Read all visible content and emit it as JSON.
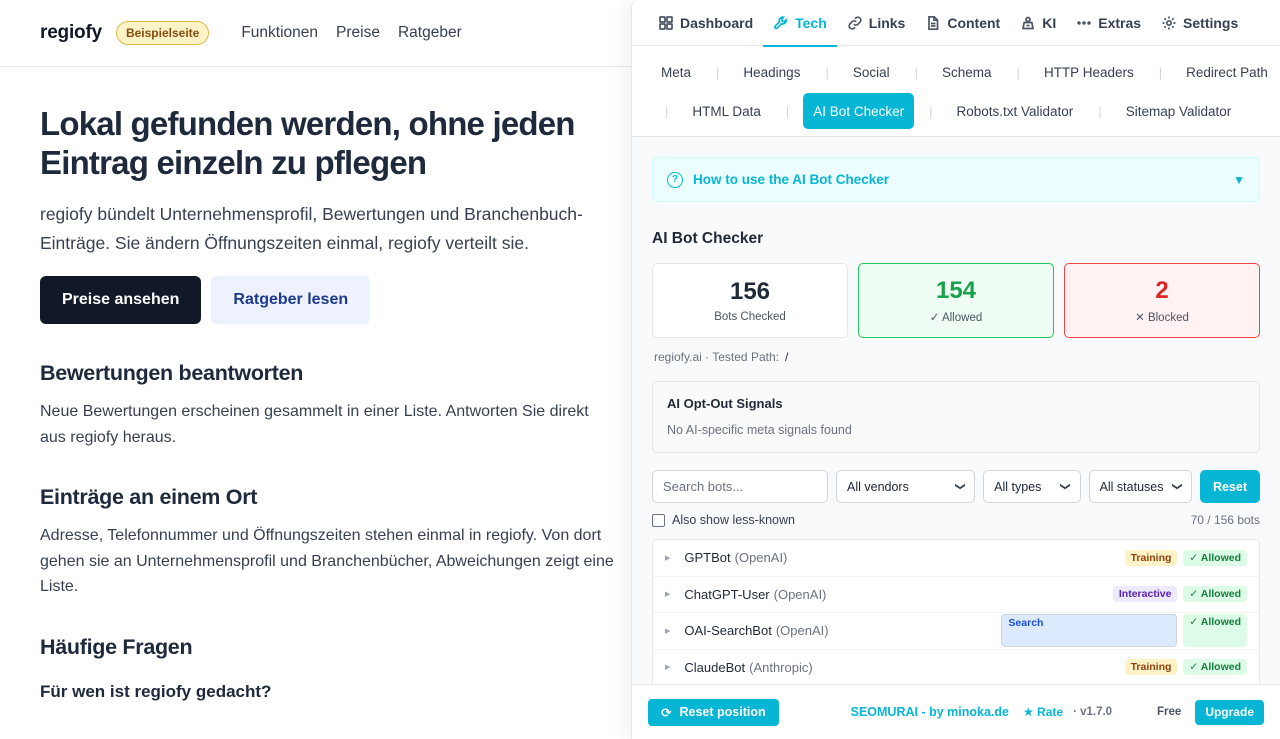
{
  "site": {
    "logo": "regiofy",
    "demo_badge": "Beispielseite",
    "nav": [
      "Funktionen",
      "Preise",
      "Ratgeber"
    ],
    "hero_title": "Lokal gefunden werden, ohne jeden Eintrag einzeln zu pflegen",
    "hero_sub": "regiofy bündelt Unternehmensprofil, Bewertungen und Branchenbuch-Einträge. Sie ändern Öffnungszeiten einmal, regiofy verteilt sie.",
    "cta_primary": "Preise ansehen",
    "cta_secondary": "Ratgeber lesen",
    "section1_title": "Bewertungen beantworten",
    "section1_text": "Neue Bewertungen erscheinen gesammelt in einer Liste. Antworten Sie direkt aus regiofy heraus.",
    "section2_title": "Einträge an einem Ort",
    "section2_text": "Adresse, Telefonnummer und Öffnungszeiten stehen einmal in regiofy. Von dort gehen sie an Unternehmensprofil und Branchenbücher, Abweichungen zeigt eine Liste.",
    "faq_title": "Häufige Fragen",
    "faq_q1": "Für wen ist regiofy gedacht?"
  },
  "panel": {
    "main_tabs": [
      {
        "label": "Dashboard",
        "icon": "grid-icon"
      },
      {
        "label": "Tech",
        "icon": "wrench-icon",
        "active": true
      },
      {
        "label": "Links",
        "icon": "link-icon"
      },
      {
        "label": "Content",
        "icon": "document-icon"
      },
      {
        "label": "KI",
        "icon": "robot-icon"
      },
      {
        "label": "Extras",
        "icon": "more-icon"
      },
      {
        "label": "Settings",
        "icon": "gear-icon"
      }
    ],
    "sub_tabs": [
      "Meta",
      "Headings",
      "Social",
      "Schema",
      "HTTP Headers",
      "Redirect Path",
      "HTML Data",
      "AI Bot Checker",
      "Robots.txt Validator",
      "Sitemap Validator"
    ],
    "sub_tab_active": "AI Bot Checker",
    "howto": "How to use the AI Bot Checker",
    "checker_title": "AI Bot Checker",
    "stats": {
      "checked_value": "156",
      "checked_label": "Bots Checked",
      "allowed_value": "154",
      "allowed_label": "✓ Allowed",
      "blocked_value": "2",
      "blocked_label": "✕ Blocked"
    },
    "tested_prefix": "regiofy.ai · Tested Path:",
    "tested_path": "/",
    "optout_title": "AI Opt-Out Signals",
    "optout_text": "No AI-specific meta signals found",
    "search_placeholder": "Search bots...",
    "vendor_select": "All vendors",
    "type_select": "All types",
    "status_select": "All statuses",
    "reset_label": "Reset",
    "less_known_label": "Also show less-known",
    "count": "70 / 156 bots",
    "bots": [
      {
        "name": "GPTBot",
        "vendor": "(OpenAI)",
        "type": "Training",
        "status": "✓ Allowed"
      },
      {
        "name": "ChatGPT-User",
        "vendor": "(OpenAI)",
        "type": "Interactive",
        "status": "✓ Allowed"
      },
      {
        "name": "OAI-SearchBot",
        "vendor": "(OpenAI)",
        "type": "Search",
        "status": "✓ Allowed"
      },
      {
        "name": "ClaudeBot",
        "vendor": "(Anthropic)",
        "type": "Training",
        "status": "✓ Allowed"
      }
    ],
    "footer": {
      "reset_position": "Reset position",
      "credit": "SEOMURAI - by minoka.de",
      "rate": "★ Rate",
      "version": "· v1.7.0",
      "plan": "Free",
      "upgrade": "Upgrade"
    }
  },
  "colors": {
    "accent": "#06b6d4",
    "allowed": "#16a34a",
    "blocked": "#dc2626"
  }
}
